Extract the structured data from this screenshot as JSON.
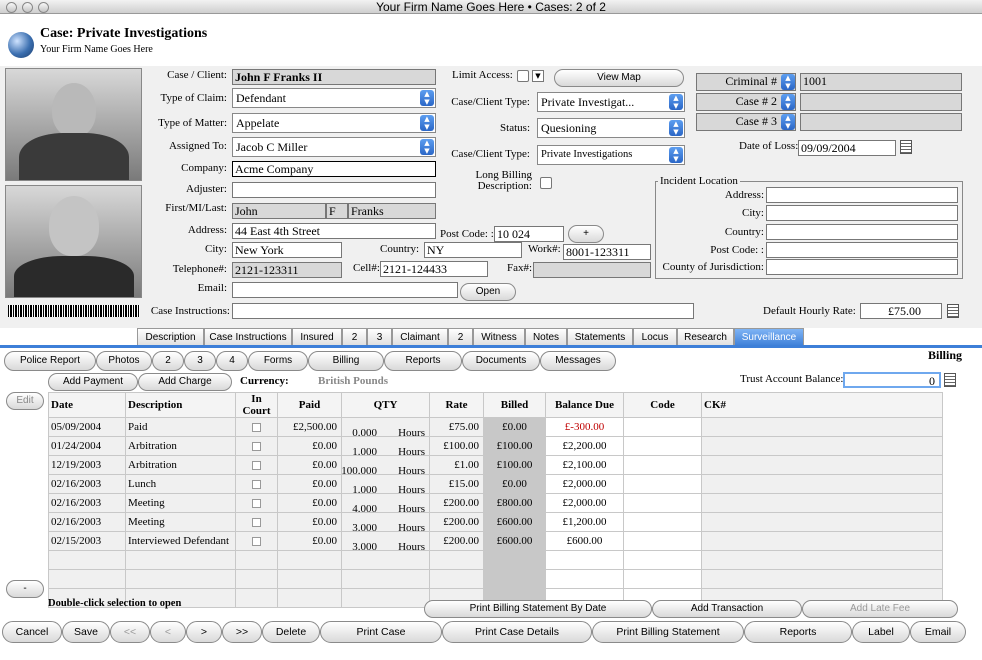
{
  "window": {
    "title": "Your Firm Name Goes Here  •  Cases: 2 of 2"
  },
  "header": {
    "case_title": "Case:  Private Investigations",
    "firm_name": "Your Firm Name Goes Here"
  },
  "form": {
    "case_client": {
      "label": "Case / Client:",
      "value": "John F Franks II"
    },
    "type_of_claim": {
      "label": "Type of Claim:",
      "value": "Defendant"
    },
    "type_of_matter": {
      "label": "Type of Matter:",
      "value": "Appelate"
    },
    "assigned_to": {
      "label": "Assigned To:",
      "value": "Jacob C Miller"
    },
    "company": {
      "label": "Company:",
      "value": "Acme Company"
    },
    "adjuster": {
      "label": "Adjuster:",
      "value": ""
    },
    "name": {
      "label": "First/MI/Last:",
      "first": "John",
      "mi": "F",
      "last": "Franks"
    },
    "address": {
      "label": "Address:",
      "value": "44 East 4th Street"
    },
    "post_code": {
      "label": "Post Code: :",
      "value": "10 024"
    },
    "city": {
      "label": "City:",
      "value": "New York"
    },
    "country": {
      "label": "Country:",
      "value": "NY"
    },
    "work": {
      "label": "Work#:",
      "value": "8001-123311"
    },
    "telephone": {
      "label": "Telephone#:",
      "value": "2121-123311"
    },
    "cell": {
      "label": "Cell#:",
      "value": "2121-124433"
    },
    "fax": {
      "label": "Fax#:",
      "value": ""
    },
    "email": {
      "label": "Email:",
      "value": ""
    },
    "case_instructions": {
      "label": "Case Instructions:",
      "value": ""
    },
    "limit_access": {
      "label": "Limit Access:"
    },
    "case_client_type1": {
      "label": "Case/Client Type:",
      "value": "Private Investigat..."
    },
    "status": {
      "label": "Status:",
      "value": "Quesioning"
    },
    "case_client_type2": {
      "label": "Case/Client Type:",
      "value": "Private Investigations"
    },
    "long_billing": {
      "label1": "Long Billing",
      "label2": "Description:"
    },
    "criminal": {
      "label": "Criminal #",
      "value": "1001"
    },
    "case2": {
      "label": "Case # 2",
      "value": ""
    },
    "case3": {
      "label": "Case # 3",
      "value": ""
    },
    "date_of_loss": {
      "label": "Date of Loss:",
      "value": "09/09/2004"
    },
    "incident": {
      "title": "Incident Location",
      "address": "Address:",
      "city": "City:",
      "country": "Country:",
      "post_code": "Post Code: :",
      "county": "County of Jurisdiction:"
    },
    "hourly_rate": {
      "label": "Default Hourly Rate:",
      "value": "£75.00"
    }
  },
  "buttons": {
    "view_map": "View Map",
    "plus": "+",
    "open": "Open"
  },
  "tabs": [
    "Description",
    "Case Instructions",
    "Insured",
    "2",
    "3",
    "Claimant",
    "2",
    "Witness",
    "Notes",
    "Statements",
    "Locus",
    "Research",
    "Surveillance"
  ],
  "subtabs": [
    "Police Report",
    "Photos",
    "2",
    "3",
    "4",
    "Forms",
    "Billing",
    "Reports",
    "Documents",
    "Messages"
  ],
  "billing": {
    "section_title": "Billing",
    "add_payment": "Add Payment",
    "add_charge": "Add Charge",
    "currency_label": "Currency:",
    "currency_value": "British Pounds",
    "trust_label": "Trust Account Balance:",
    "trust_value": "0",
    "edit_button": "Edit",
    "minus_button": "-",
    "headers": [
      "Date",
      "Description",
      "In Court",
      "Paid",
      "QTY",
      "Rate",
      "Billed",
      "Balance Due",
      "Code",
      "CK#"
    ],
    "rows": [
      {
        "date": "05/09/2004",
        "desc": "Paid",
        "paid": "£2,500.00",
        "qty": "0.000",
        "unit": "Hours",
        "rate": "£75.00",
        "billed": "£0.00",
        "balance": "£-300.00",
        "neg": true
      },
      {
        "date": "01/24/2004",
        "desc": "Arbitration",
        "paid": "£0.00",
        "qty": "1.000",
        "unit": "Hours",
        "rate": "£100.00",
        "billed": "£100.00",
        "balance": "£2,200.00"
      },
      {
        "date": "12/19/2003",
        "desc": "Arbitration",
        "paid": "£0.00",
        "qty": "100.000",
        "unit": "Hours",
        "rate": "£1.00",
        "billed": "£100.00",
        "balance": "£2,100.00"
      },
      {
        "date": "02/16/2003",
        "desc": "Lunch",
        "paid": "£0.00",
        "qty": "1.000",
        "unit": "Hours",
        "rate": "£15.00",
        "billed": "£0.00",
        "balance": "£2,000.00"
      },
      {
        "date": "02/16/2003",
        "desc": "Meeting",
        "paid": "£0.00",
        "qty": "4.000",
        "unit": "Hours",
        "rate": "£200.00",
        "billed": "£800.00",
        "balance": "£2,000.00"
      },
      {
        "date": "02/16/2003",
        "desc": "Meeting",
        "paid": "£0.00",
        "qty": "3.000",
        "unit": "Hours",
        "rate": "£200.00",
        "billed": "£600.00",
        "balance": "£1,200.00"
      },
      {
        "date": "02/15/2003",
        "desc": "Interviewed Defendant",
        "paid": "£0.00",
        "qty": "3.000",
        "unit": "Hours",
        "rate": "£200.00",
        "billed": "£600.00",
        "balance": "£600.00"
      }
    ],
    "hint": "Double-click selection to open",
    "print_by_date": "Print Billing Statement By Date",
    "add_transaction": "Add Transaction",
    "add_late_fee": "Add Late Fee"
  },
  "bottom": [
    "Cancel",
    "Save",
    "<<",
    "<",
    ">",
    ">>",
    "Delete",
    "Print Case",
    "Print Case Details",
    "Print Billing Statement",
    "Reports",
    "Label",
    "Email"
  ]
}
